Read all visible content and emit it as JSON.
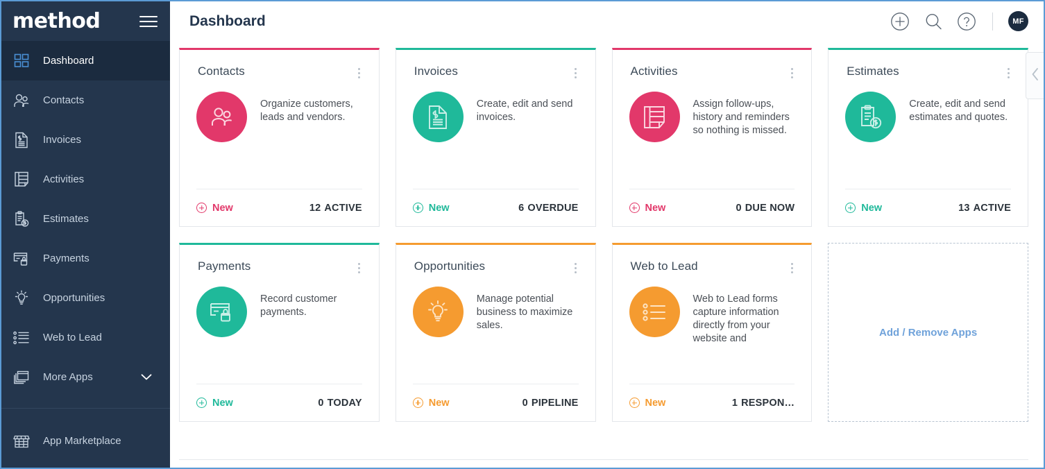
{
  "brand": {
    "logo_text": "method",
    "menu_icon": "hamburger-icon"
  },
  "sidebar": {
    "items": [
      {
        "label": "Dashboard",
        "icon": "grid-icon",
        "active": true
      },
      {
        "label": "Contacts",
        "icon": "people-icon",
        "active": false
      },
      {
        "label": "Invoices",
        "icon": "invoice-document-icon",
        "active": false
      },
      {
        "label": "Activities",
        "icon": "list-note-icon",
        "active": false
      },
      {
        "label": "Estimates",
        "icon": "clipboard-dollar-icon",
        "active": false
      },
      {
        "label": "Payments",
        "icon": "credit-card-lock-icon",
        "active": false
      },
      {
        "label": "Opportunities",
        "icon": "lightbulb-icon",
        "active": false
      },
      {
        "label": "Web to Lead",
        "icon": "form-list-icon",
        "active": false
      },
      {
        "label": "More Apps",
        "icon": "windows-stack-icon",
        "active": false,
        "chevron": "chevron-down-icon"
      }
    ],
    "bottom": {
      "label": "App Marketplace",
      "icon": "storefront-icon"
    }
  },
  "header": {
    "title": "Dashboard",
    "add_icon": "plus-circle-icon",
    "search_icon": "search-icon",
    "help_icon": "question-circle-icon",
    "avatar_initials": "MF"
  },
  "colors": {
    "sidebar_bg": "#24364d",
    "sidebar_active": "#1b2b3f",
    "pink": "#e23d6d",
    "green": "#27b99a",
    "orange": "#f59b30",
    "link_blue": "#6fa2da",
    "page_border": "#5b9bd5"
  },
  "cards": [
    {
      "title": "Contacts",
      "accent": "#e2386a",
      "icon": "people-icon",
      "description": "Organize customers, leads and vendors.",
      "new_label": "New",
      "stat_number": "12",
      "stat_label": "ACTIVE",
      "menu_icon": "kebab-menu-icon"
    },
    {
      "title": "Invoices",
      "accent": "#1fb99a",
      "icon": "invoice-document-icon",
      "description": "Create, edit and send invoices.",
      "new_label": "New",
      "stat_number": "6",
      "stat_label": "OVERDUE",
      "menu_icon": "kebab-menu-icon"
    },
    {
      "title": "Activities",
      "accent": "#e2386a",
      "icon": "list-note-icon",
      "description": "Assign follow-ups, history and reminders so nothing is missed.",
      "new_label": "New",
      "stat_number": "0",
      "stat_label": "DUE NOW",
      "menu_icon": "kebab-menu-icon"
    },
    {
      "title": "Estimates",
      "accent": "#1fb99a",
      "icon": "clipboard-dollar-icon",
      "description": "Create, edit and send estimates and quotes.",
      "new_label": "New",
      "stat_number": "13",
      "stat_label": "ACTIVE",
      "menu_icon": "kebab-menu-icon"
    },
    {
      "title": "Payments",
      "accent": "#1fb99a",
      "icon": "credit-card-lock-icon",
      "description": "Record customer payments.",
      "new_label": "New",
      "stat_number": "0",
      "stat_label": "TODAY",
      "menu_icon": "kebab-menu-icon"
    },
    {
      "title": "Opportunities",
      "accent": "#f59b30",
      "icon": "lightbulb-icon",
      "description": "Manage potential business to maximize sales.",
      "new_label": "New",
      "stat_number": "0",
      "stat_label": "PIPELINE",
      "menu_icon": "kebab-menu-icon"
    },
    {
      "title": "Web to Lead",
      "accent": "#f59b30",
      "icon": "form-list-icon",
      "description": "Web to Lead forms capture information directly from your website and",
      "new_label": "New",
      "stat_number": "1",
      "stat_label": "RESPON…",
      "menu_icon": "kebab-menu-icon"
    }
  ],
  "add_remove": {
    "label": "Add / Remove Apps"
  },
  "collapse_panel": {
    "icon": "chevron-left-icon"
  }
}
